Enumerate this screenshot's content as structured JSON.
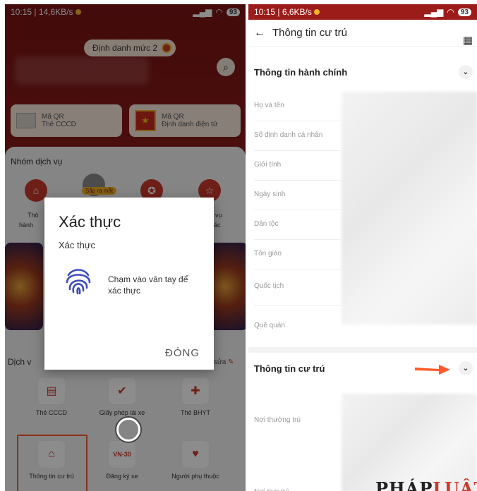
{
  "left_screen": {
    "status_bar": {
      "time_speed": "10:15 | 14,6KB/s",
      "battery": "93"
    },
    "level_badge": "Định danh mức 2",
    "qr_cards": [
      {
        "line1": "Mã QR",
        "line2": "Thẻ CCCD"
      },
      {
        "line1": "Mã QR",
        "line2": "Định danh điện tử"
      }
    ],
    "service_group_title": "Nhóm dịch vụ",
    "coming_soon_badge": "Sắp ra mắt",
    "partial_labels": {
      "left_top": "Thô",
      "left_bottom": "hành",
      "right_top": "vụ",
      "right_bottom": "ác",
      "section_left": "Dịch v"
    },
    "edit_link": "sửa",
    "services": [
      {
        "label": "Thẻ CCCD",
        "icon": "id-card-icon"
      },
      {
        "label": "Giấy phép lái xe",
        "icon": "car-license-icon"
      },
      {
        "label": "Thẻ BHYT",
        "icon": "health-insurance-icon"
      },
      {
        "label": "Thông tin cư trú",
        "icon": "house-family-icon"
      },
      {
        "label": "Đăng ký xe",
        "icon": "vehicle-plate-icon",
        "plate": "VN-30"
      },
      {
        "label": "Người phụ thuộc",
        "icon": "dependents-icon"
      }
    ],
    "dialog": {
      "title": "Xác thực",
      "subtitle": "Xác thực",
      "prompt": "Chạm vào vân tay để xác thực",
      "close_button": "ĐÓNG"
    }
  },
  "right_screen": {
    "status_bar": {
      "time_speed": "10:15 | 6,6KB/s",
      "battery": "93"
    },
    "header_title": "Thông tin cư trú",
    "admin_section": {
      "title": "Thông tin hành chính",
      "fields": [
        "Họ và tên",
        "Số định danh cá nhân",
        "Giới tính",
        "Ngày sinh",
        "Dân tộc",
        "Tôn giáo",
        "Quốc tịch",
        "Quê quán"
      ]
    },
    "residence_section": {
      "title": "Thông tin cư trú",
      "fields": [
        "Nơi thường trú",
        "Nơi tạm trú"
      ]
    },
    "watermark": {
      "part1": "PHÁP",
      "part2": "LUẬT"
    }
  },
  "colors": {
    "brand_red": "#c93a2c",
    "dark_red": "#7a1414",
    "accent_gold": "#f0b429",
    "arrow_orange": "#ff5a2a"
  }
}
